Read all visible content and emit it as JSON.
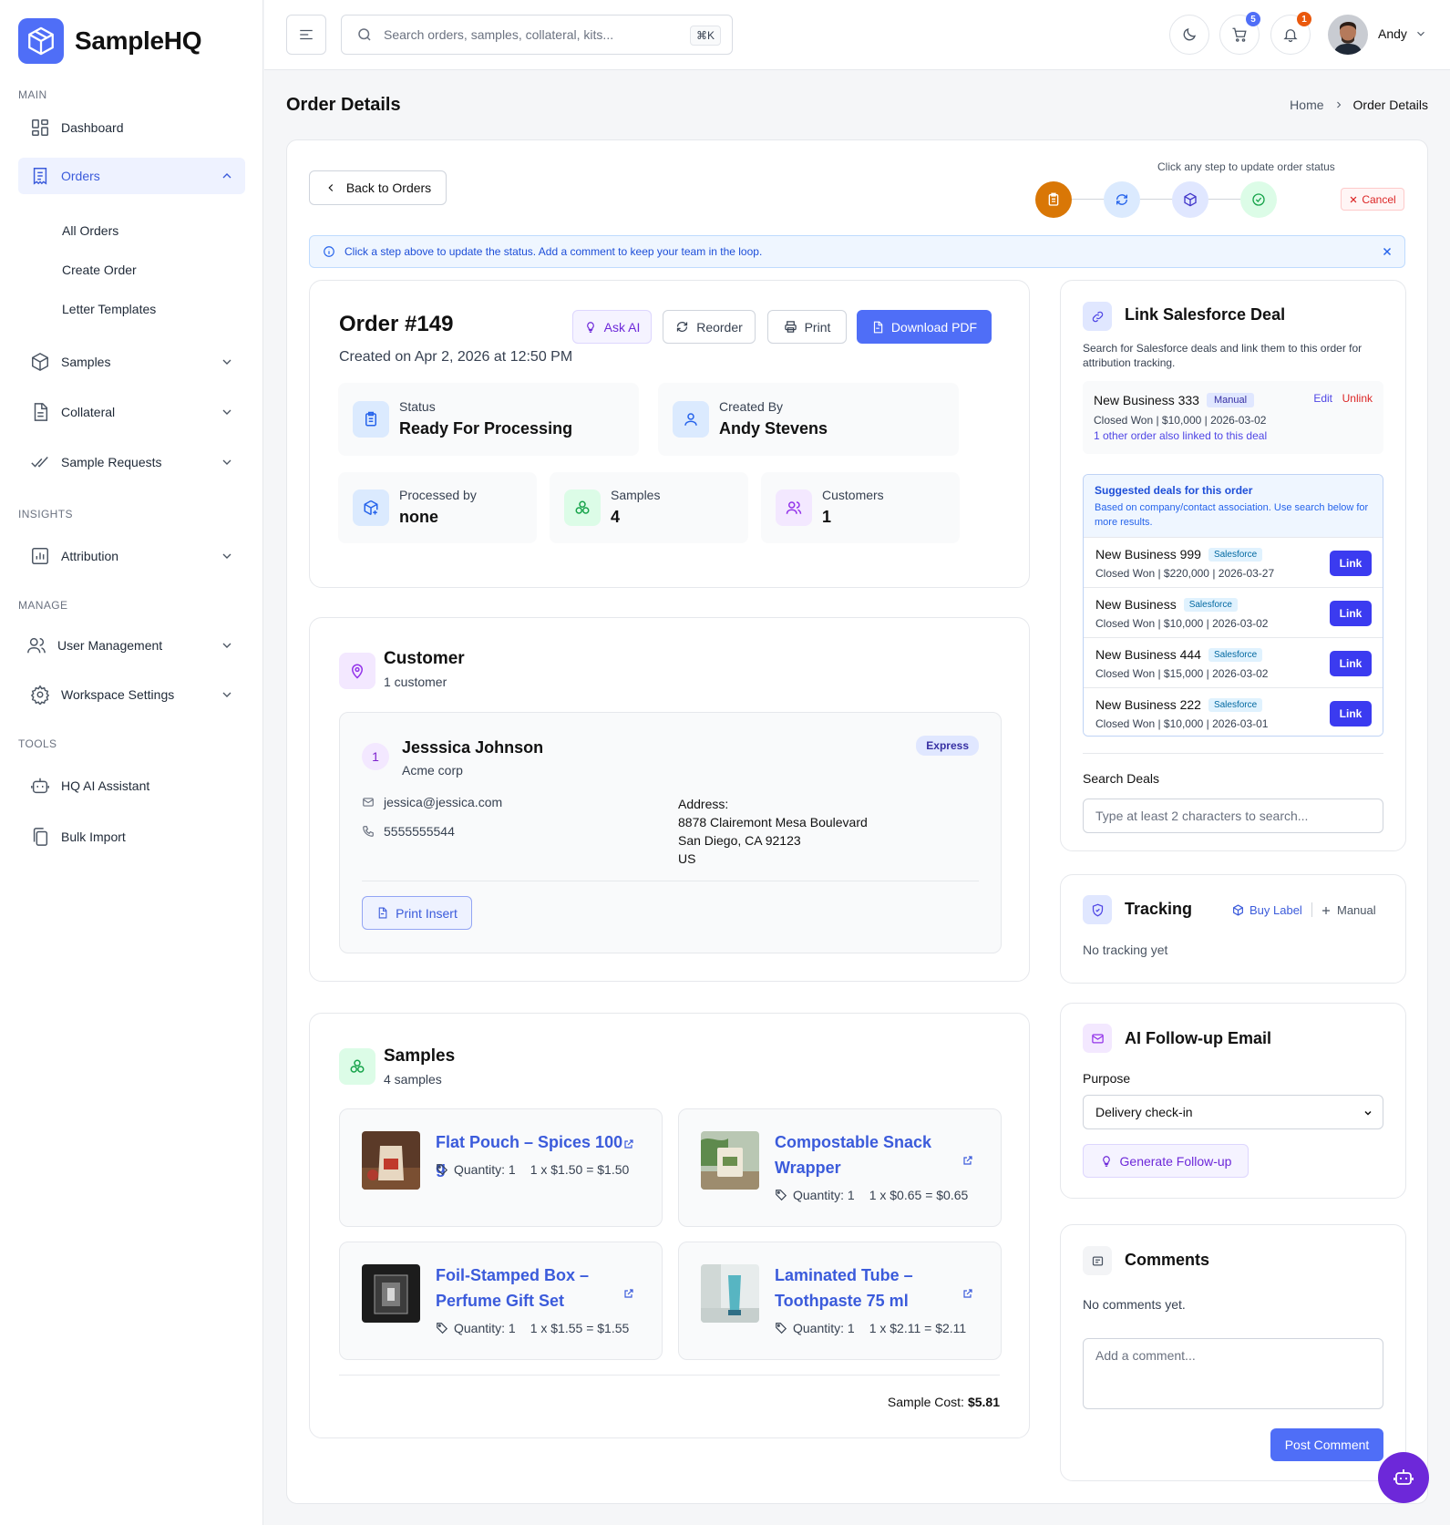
{
  "app": {
    "name": "SampleHQ"
  },
  "sidebar": {
    "sections": {
      "main": "MAIN",
      "insights": "INSIGHTS",
      "manage": "MANAGE",
      "tools": "TOOLS"
    },
    "items": {
      "dashboard": "Dashboard",
      "orders": "Orders",
      "all_orders": "All Orders",
      "create_order": "Create Order",
      "letter_templates": "Letter Templates",
      "samples": "Samples",
      "collateral": "Collateral",
      "sample_requests": "Sample Requests",
      "attribution": "Attribution",
      "user_management": "User Management",
      "workspace_settings": "Workspace Settings",
      "hq_ai_assistant": "HQ AI Assistant",
      "bulk_import": "Bulk Import"
    }
  },
  "topbar": {
    "search_placeholder": "Search orders, samples, collateral, kits...",
    "shortcut": "⌘K",
    "cart_count": "5",
    "notification_count": "1",
    "user_name": "Andy"
  },
  "page": {
    "title": "Order Details",
    "breadcrumb": {
      "home": "Home",
      "current": "Order Details"
    }
  },
  "status_bar": {
    "back_label": "Back to Orders",
    "hint": "Click any step to update order status",
    "cancel_label": "Cancel",
    "info": "Click a step above to update the status. Add a comment to keep your team in the loop."
  },
  "order": {
    "title": "Order #149",
    "created": "Created on Apr 2, 2026 at 12:50 PM",
    "actions": {
      "ask_ai": "Ask AI",
      "reorder": "Reorder",
      "print": "Print",
      "download_pdf": "Download PDF"
    },
    "status_label": "Status",
    "status_value": "Ready For Processing",
    "created_by_label": "Created By",
    "created_by_value": "Andy Stevens",
    "processed_by_label": "Processed by",
    "processed_by_value": "none",
    "samples_label": "Samples",
    "samples_value": "4",
    "customers_label": "Customers",
    "customers_value": "1"
  },
  "customer_section": {
    "title": "Customer",
    "subtitle": "1 customer",
    "customer": {
      "index": "1",
      "name": "Jesssica Johnson",
      "company": "Acme corp",
      "badge": "Express",
      "email": "jessica@jessica.com",
      "phone": "5555555544",
      "address_label": "Address:",
      "address_line1": "8878 Clairemont Mesa Boulevard",
      "address_line2": "San Diego, CA 92123",
      "address_line3": "US"
    },
    "print_insert": "Print Insert"
  },
  "samples_section": {
    "title": "Samples",
    "subtitle": "4 samples",
    "items": [
      {
        "name": "Flat Pouch – Spices 100 g",
        "qty": "Quantity: 1",
        "price": "1 x $1.50 = $1.50"
      },
      {
        "name": "Compostable Snack Wrapper",
        "qty": "Quantity: 1",
        "price": "1 x $0.65 = $0.65"
      },
      {
        "name": "Foil-Stamped Box – Perfume Gift Set",
        "qty": "Quantity: 1",
        "price": "1 x $1.55 = $1.55"
      },
      {
        "name": "Laminated Tube – Toothpaste 75 ml",
        "qty": "Quantity: 1",
        "price": "1 x $2.11 = $2.11"
      }
    ],
    "cost_label": "Sample Cost:",
    "cost_value": "$5.81"
  },
  "salesforce": {
    "title": "Link Salesforce Deal",
    "description": "Search for Salesforce deals and link them to this order for attribution tracking.",
    "linked": {
      "name": "New Business 333",
      "tag": "Manual",
      "edit": "Edit",
      "unlink": "Unlink",
      "info": "Closed Won | $10,000 | 2026-03-02",
      "note": "1 other order also linked to this deal"
    },
    "suggested_title": "Suggested deals for this order",
    "suggested_desc": "Based on company/contact association. Use search below for more results.",
    "suggested": [
      {
        "name": "New Business 999",
        "tag": "Salesforce",
        "info": "Closed Won | $220,000 | 2026-03-27",
        "action": "Link"
      },
      {
        "name": "New Business",
        "tag": "Salesforce",
        "info": "Closed Won | $10,000 | 2026-03-02",
        "action": "Link"
      },
      {
        "name": "New Business 444",
        "tag": "Salesforce",
        "info": "Closed Won | $15,000 | 2026-03-02",
        "action": "Link"
      },
      {
        "name": "New Business 222",
        "tag": "Salesforce",
        "info": "Closed Won | $10,000 | 2026-03-01",
        "action": "Link"
      }
    ],
    "search_label": "Search Deals",
    "search_placeholder": "Type at least 2 characters to search..."
  },
  "tracking": {
    "title": "Tracking",
    "buy_label": "Buy Label",
    "manual": "Manual",
    "empty": "No tracking yet"
  },
  "followup": {
    "title": "AI Follow-up Email",
    "purpose_label": "Purpose",
    "purpose_value": "Delivery check-in",
    "generate": "Generate Follow-up"
  },
  "comments": {
    "title": "Comments",
    "empty": "No comments yet.",
    "placeholder": "Add a comment...",
    "post": "Post Comment"
  },
  "colors": {
    "accent": "#4f6ef7",
    "step_active": "#d97706",
    "danger": "#dc2626",
    "link_button": "#3b3bf0"
  }
}
